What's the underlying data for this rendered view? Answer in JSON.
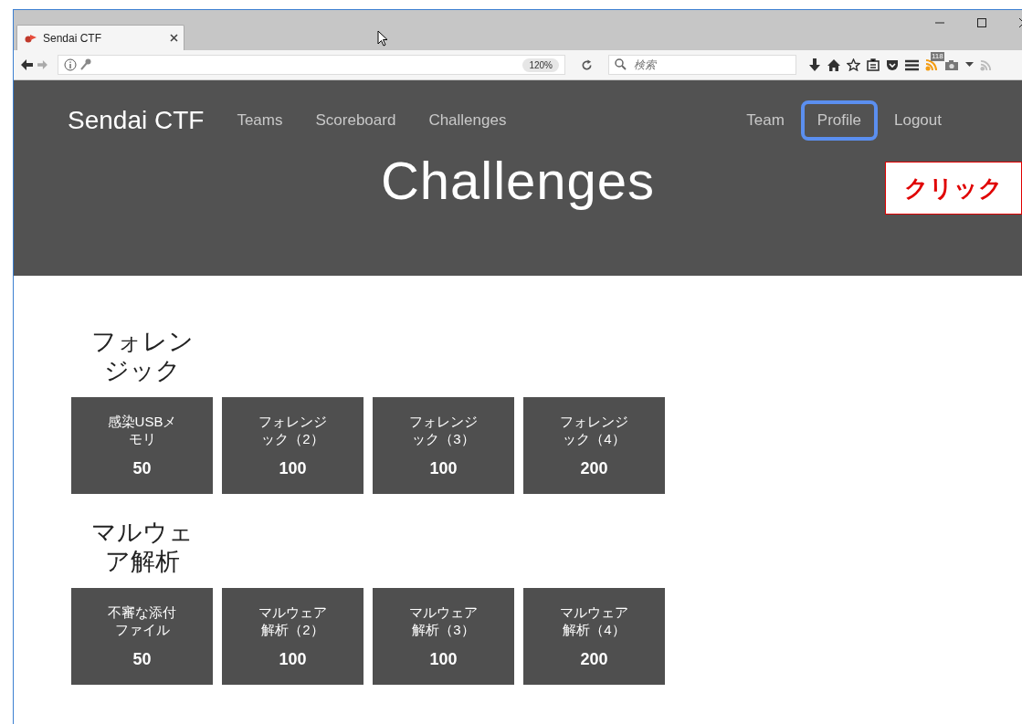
{
  "browser": {
    "tab_title": "Sendai CTF",
    "zoom": "120%",
    "search_placeholder": "検索",
    "badge": "118"
  },
  "navbar": {
    "brand": "Sendai CTF",
    "left_links": [
      {
        "label": "Teams"
      },
      {
        "label": "Scoreboard"
      },
      {
        "label": "Challenges"
      }
    ],
    "right_links": [
      {
        "label": "Team",
        "highlighted": false
      },
      {
        "label": "Profile",
        "highlighted": true
      },
      {
        "label": "Logout",
        "highlighted": false
      }
    ]
  },
  "callout": "クリック",
  "page_title": "Challenges",
  "categories": [
    {
      "title": "フォレンジック",
      "challenges": [
        {
          "name": "感染USBメモリ",
          "points": "50"
        },
        {
          "name": "フォレンジック（2）",
          "points": "100"
        },
        {
          "name": "フォレンジック（3）",
          "points": "100"
        },
        {
          "name": "フォレンジック（4）",
          "points": "200"
        }
      ]
    },
    {
      "title": "マルウェア解析",
      "challenges": [
        {
          "name": "不審な添付ファイル",
          "points": "50"
        },
        {
          "name": "マルウェア解析（2）",
          "points": "100"
        },
        {
          "name": "マルウェア解析（3）",
          "points": "100"
        },
        {
          "name": "マルウェア解析（4）",
          "points": "200"
        }
      ]
    }
  ]
}
